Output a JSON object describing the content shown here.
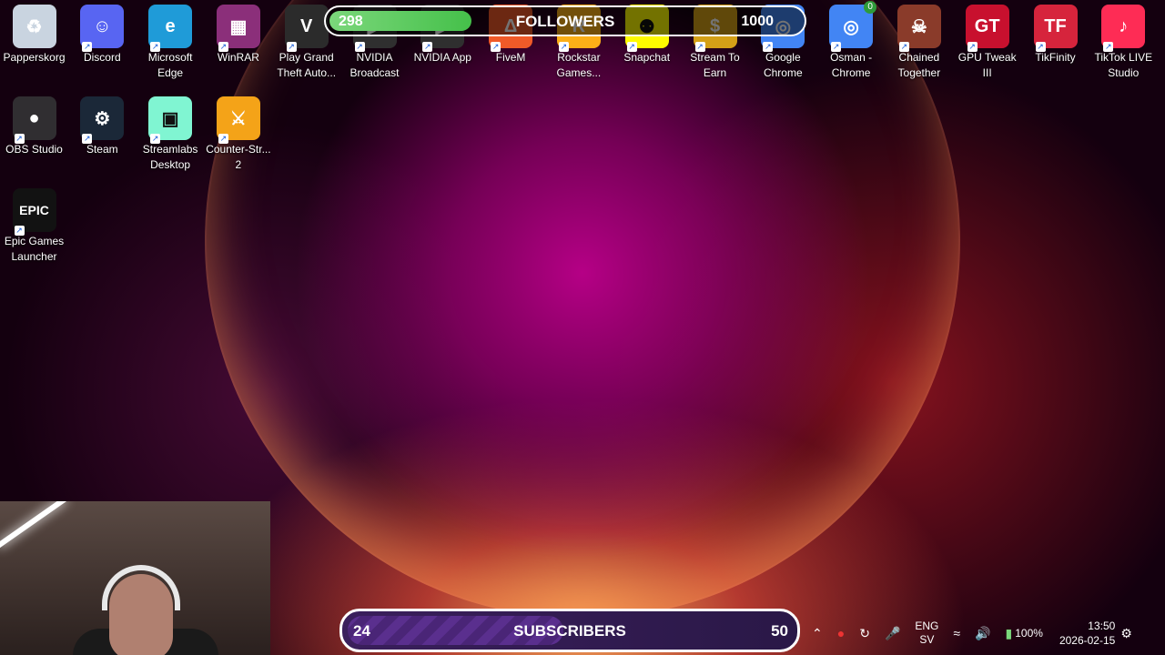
{
  "desktop_icons": [
    {
      "label": "Papperskorg",
      "icon": "recycle-bin-icon",
      "color": "#c9d4e0"
    },
    {
      "label": "Discord",
      "icon": "discord-icon",
      "color": "#5865f2"
    },
    {
      "label": "Microsoft Edge",
      "icon": "edge-icon",
      "color": "#1f9bd8"
    },
    {
      "label": "WinRAR",
      "icon": "winrar-icon",
      "color": "#8b2f7a"
    },
    {
      "label": "Play Grand Theft Auto...",
      "icon": "gta-v-icon",
      "color": "#2b2b2b"
    },
    {
      "label": "NVIDIA Broadcast",
      "icon": "nvidia-broadcast-icon",
      "color": "#2f2f2f"
    },
    {
      "label": "NVIDIA App",
      "icon": "nvidia-app-icon",
      "color": "#2f2f2f"
    },
    {
      "label": "FiveM",
      "icon": "fivem-icon",
      "color": "#f05a28"
    },
    {
      "label": "Rockstar Games...",
      "icon": "rockstar-icon",
      "color": "#fcaf17"
    },
    {
      "label": "Snapchat",
      "icon": "snapchat-icon",
      "color": "#fffc00"
    },
    {
      "label": "Stream To Earn",
      "icon": "stream-to-earn-icon",
      "color": "#d4a017"
    },
    {
      "label": "Google Chrome",
      "icon": "chrome-icon",
      "color": "#4285f4"
    },
    {
      "label": "Osman - Chrome",
      "icon": "chrome-profile-icon",
      "color": "#4285f4"
    },
    {
      "label": "Chained Together",
      "icon": "chained-together-icon",
      "color": "#8a3b2a"
    },
    {
      "label": "GPU Tweak III",
      "icon": "gpu-tweak-icon",
      "color": "#c8102e"
    },
    {
      "label": "TikFinity",
      "icon": "tikfinity-icon",
      "color": "#d6243c"
    },
    {
      "label": "TikTok LIVE Studio",
      "icon": "tiktok-live-icon",
      "color": "#fe2c55"
    },
    {
      "label": "OBS Studio",
      "icon": "obs-icon",
      "color": "#302e31"
    },
    {
      "label": "Steam",
      "icon": "steam-icon",
      "color": "#1b2838"
    },
    {
      "label": "Streamlabs Desktop",
      "icon": "streamlabs-icon",
      "color": "#80f5d2"
    },
    {
      "label": "Counter-Str... 2",
      "icon": "cs2-icon",
      "color": "#f4a318"
    },
    {
      "label": "Epic Games Launcher",
      "icon": "epic-games-icon",
      "color": "#121212"
    }
  ],
  "chrome_badge": "0",
  "followers_bar": {
    "title": "FOLLOWERS",
    "current": "298",
    "goal": "1000",
    "progress_fraction": 0.298
  },
  "subscribers_bar": {
    "title": "SUBSCRIBERS",
    "current": "24",
    "goal": "50",
    "progress_fraction": 0.48
  },
  "tray": {
    "lang_top": "ENG",
    "lang_bottom": "SV",
    "battery": "100%",
    "time": "13:50",
    "date": "2026-02-15"
  }
}
